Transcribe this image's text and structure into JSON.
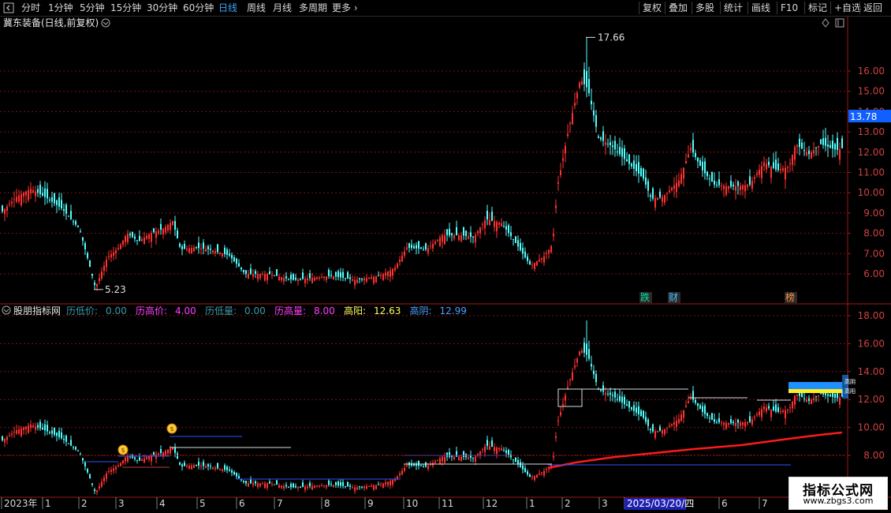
{
  "toolbar": {
    "menu_icon": "collapse-icon",
    "periods": [
      "分时",
      "1分钟",
      "5分钟",
      "15分钟",
      "30分钟",
      "60分钟",
      "日线",
      "周线",
      "月线",
      "多周期"
    ],
    "active_period": "日线",
    "more_label": "更多",
    "right_buttons": [
      "复权",
      "叠加",
      "多股",
      "统计",
      "画线",
      "F10",
      "标记",
      "+自选",
      "返回"
    ]
  },
  "main_panel": {
    "title": "冀东装备(日线,前复权)",
    "high_label": "17.66",
    "low_label": "5.23",
    "current_price": "13.78",
    "y_ticks": [
      "16.00",
      "15.00",
      "14.00",
      "13.00",
      "12.00",
      "11.00",
      "10.00",
      "9.00",
      "8.00",
      "7.00",
      "6.00"
    ],
    "markers": [
      {
        "text": "跌",
        "color": "#00e0a0"
      },
      {
        "text": "财",
        "color": "#40c0ff"
      },
      {
        "text": "榜",
        "color": "#ff9040"
      }
    ]
  },
  "indicator_panel": {
    "name": "股朋指标网",
    "fields": [
      {
        "label": "历低价:",
        "value": "0.00",
        "color": "#3a9aa8"
      },
      {
        "label": "历高价:",
        "value": "4.00",
        "color": "#ff40ff"
      },
      {
        "label": "历低量:",
        "value": "0.00",
        "color": "#3a9aa8"
      },
      {
        "label": "历高量:",
        "value": "8.00",
        "color": "#ff40ff"
      },
      {
        "label": "高阳:",
        "value": "12.63",
        "color": "#ffff60"
      },
      {
        "label": "高阴:",
        "value": "12.99",
        "color": "#4aa0ff"
      }
    ],
    "y_ticks": [
      "18.00",
      "16.00",
      "14.00",
      "12.00",
      "10.00",
      "8.00"
    ],
    "right_tags": [
      "高阴",
      "高阳"
    ]
  },
  "x_axis": {
    "labels": [
      "2023年",
      "1",
      "2",
      "3",
      "4",
      "5",
      "6",
      "7",
      "8",
      "9",
      "10",
      "11",
      "12",
      "1",
      "2",
      "3",
      "2025/03/20/四",
      "6",
      "7"
    ]
  },
  "watermark": {
    "line1": "指标公式网",
    "line2": "www.zbgs3.com"
  },
  "colors": {
    "up": "#ff3232",
    "down": "#54ffff",
    "grid": "#801010",
    "axis": "#a01818",
    "ma_red": "#ff1a1a",
    "blue_line": "#3050ff"
  }
}
